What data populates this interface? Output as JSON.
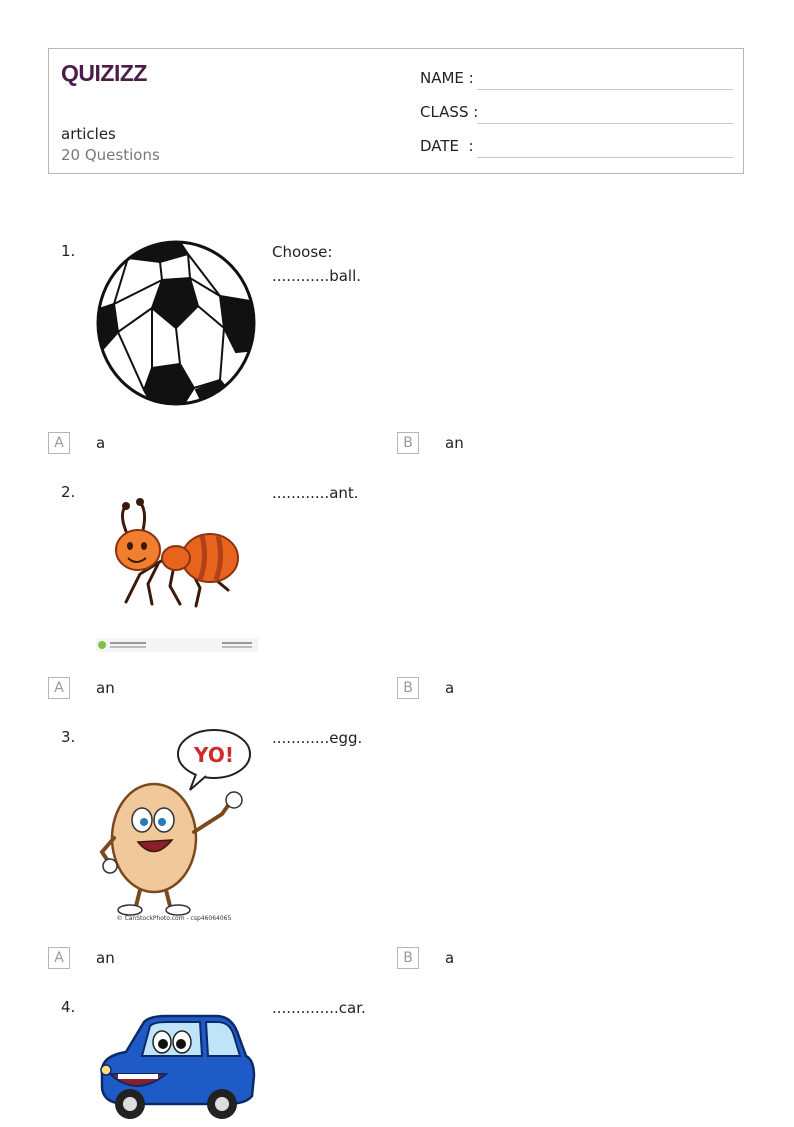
{
  "header": {
    "logo_text": "Quizizz",
    "title": "articles",
    "count": "20 Questions",
    "fields": [
      {
        "label": "NAME :"
      },
      {
        "label": "CLASS :"
      },
      {
        "label": "DATE  :"
      }
    ]
  },
  "questions": [
    {
      "number": "1.",
      "lines": [
        "Choose:",
        "............ball."
      ],
      "image": "soccer-ball",
      "options": [
        {
          "letter": "A",
          "text": "a"
        },
        {
          "letter": "B",
          "text": "an"
        }
      ]
    },
    {
      "number": "2.",
      "lines": [
        "............ant."
      ],
      "image": "cartoon-ant",
      "options": [
        {
          "letter": "A",
          "text": "an"
        },
        {
          "letter": "B",
          "text": "a"
        }
      ]
    },
    {
      "number": "3.",
      "lines": [
        "............egg."
      ],
      "image": "cartoon-egg",
      "speech_bubble": "YO!",
      "watermark": "© CanStockPhoto.com - csp46064065",
      "options": [
        {
          "letter": "A",
          "text": "an"
        },
        {
          "letter": "B",
          "text": "a"
        }
      ]
    },
    {
      "number": "4.",
      "lines": [
        "..............car."
      ],
      "image": "cartoon-car"
    }
  ]
}
